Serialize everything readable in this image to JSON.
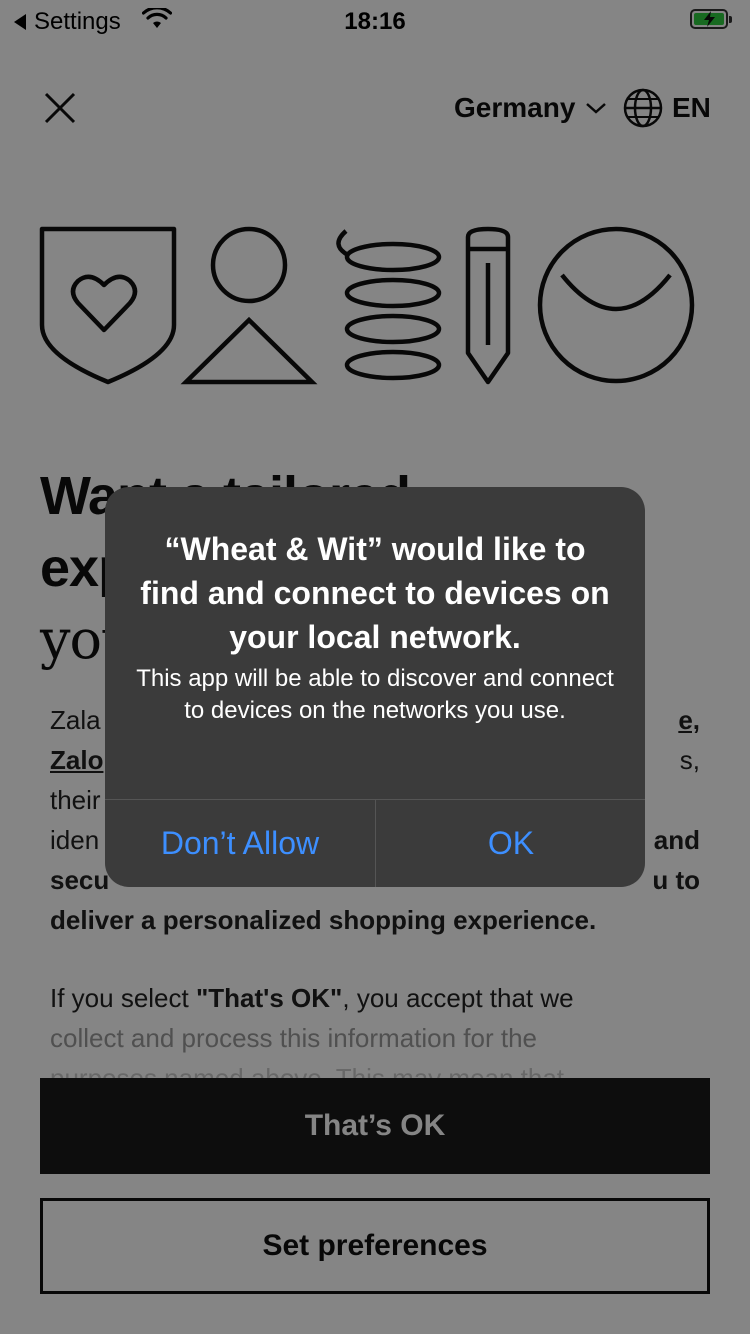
{
  "status_bar": {
    "back_label": "Settings",
    "time": "18:16"
  },
  "header": {
    "country": "Germany",
    "language": "EN"
  },
  "headline": {
    "line1": "Want a tailored",
    "line2": "experience",
    "line3": "you"
  },
  "body": {
    "p1_start": "Zala",
    "p1_link_right": "e,",
    "p1_link2": "Zalo",
    "p1_right2": "s,",
    "p1_line3": "their",
    "p1_line4": "iden",
    "p1_bold_right": "and",
    "p1_line5": "secu",
    "p1_line5_right": "u to",
    "p1_line6": "deliver a personalized shopping experience.",
    "p2_a": "If you select ",
    "p2_b": "\"That's OK\"",
    "p2_c": ", you accept that we",
    "p2_d": "collect and process this information for the",
    "p3": "purposes named above. This may mean that"
  },
  "buttons": {
    "primary": "That’s OK",
    "secondary": "Set preferences"
  },
  "alert": {
    "title": "“Wheat & Wit” would like to find and connect to devices on your local network.",
    "message": "This app will be able to discover and connect to devices on the networks you use.",
    "deny": "Don’t Allow",
    "allow": "OK",
    "button_color": "#3d8fff"
  },
  "colors": {
    "accent_dark": "#1a1a1a",
    "battery": "#2ecc40"
  }
}
